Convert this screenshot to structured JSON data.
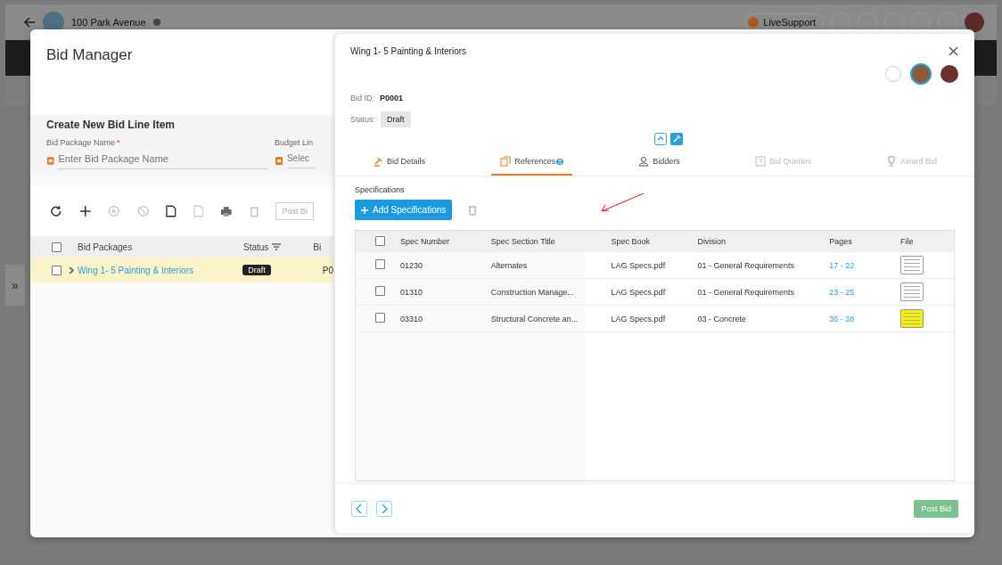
{
  "app_bar": {
    "project": "100 Park Avenue",
    "support": "LiveSupport"
  },
  "sidebar_toggle": "»",
  "bid_manager": {
    "title": "Bid Manager",
    "form_title": "Create New Bid Line Item",
    "fields": [
      {
        "label": "Bid Package Name",
        "required_mark": "*",
        "placeholder": "Enter Bid Package Name"
      },
      {
        "label": "Budget Lin",
        "placeholder": "Selec"
      }
    ],
    "toolbar_button": "Post Bi",
    "header_checked": false,
    "columns": [
      "Bid Packages",
      "Status",
      "Bi"
    ],
    "rows": [
      {
        "name": "Wing 1- 5 Painting & Interiors",
        "status": "Draft",
        "column_3": "P0",
        "checked": false,
        "selected": true
      }
    ]
  },
  "detail": {
    "title": "Wing 1- 5 Painting & Interiors",
    "bid_id_label": "Bid ID:",
    "bid_id": "P0001",
    "status_label": "Status:",
    "status": "Draft",
    "tabs": [
      {
        "label": "Bid Details",
        "selected": false,
        "disabled": false
      },
      {
        "label": "References",
        "selected": true,
        "disabled": false,
        "badge": "5"
      },
      {
        "label": "Bidders",
        "selected": false,
        "disabled": false
      },
      {
        "label": "Bid Queries",
        "selected": false,
        "disabled": true
      },
      {
        "label": "Award Bid",
        "selected": false,
        "disabled": true
      }
    ],
    "section": "Specifications",
    "add_button": "Add Specifications",
    "header_checked": false,
    "columns": [
      "Spec Number",
      "Spec Section Title",
      "Spec Book",
      "Division",
      "Pages",
      "File"
    ],
    "rows": [
      {
        "number": "01230",
        "title": "Alternates",
        "book": "LAG Specs.pdf",
        "division": "01 - General Requirements",
        "pages": "17 - 22",
        "checked": false,
        "highlighted": false
      },
      {
        "number": "01310",
        "title": "Construction Manage...",
        "book": "LAG Specs.pdf",
        "division": "01 - General Requirements",
        "pages": "23 - 25",
        "checked": false,
        "highlighted": false
      },
      {
        "number": "03310",
        "title": "Structural Concrete an...",
        "book": "LAG Specs.pdf",
        "division": "03 - Concrete",
        "pages": "36 - 38",
        "checked": false,
        "highlighted": true
      }
    ],
    "post_button": "Post Bid"
  }
}
